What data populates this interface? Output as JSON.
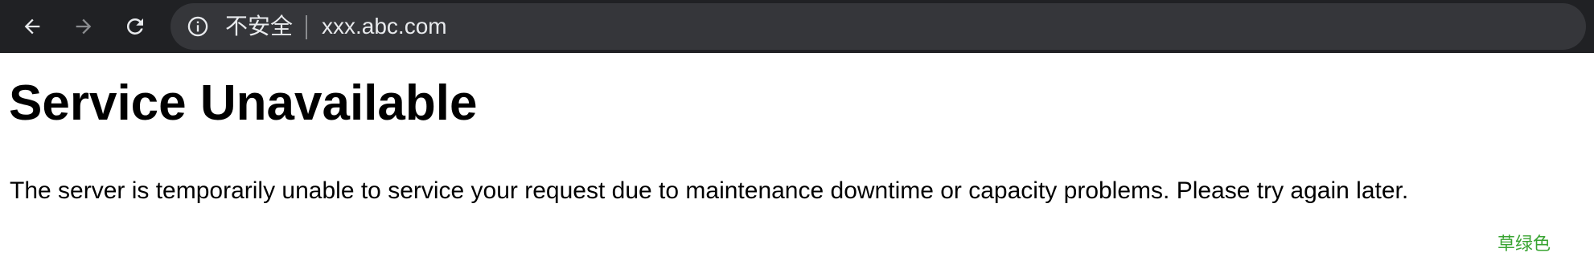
{
  "browser": {
    "security_label": "不安全",
    "url": "xxx.abc.com",
    "icons": {
      "back": "arrow-left-icon",
      "forward": "arrow-right-icon",
      "reload": "reload-icon",
      "info": "info-circle-icon"
    },
    "colors": {
      "toolbar_background": "#202124",
      "omnibox_background": "#35363a",
      "text": "#e8eaed",
      "forward_disabled": "#8a8c8f"
    }
  },
  "page": {
    "title": "Service Unavailable",
    "message": "The server is temporarily unable to service your request due to maintenance downtime or capacity problems. Please try again later."
  },
  "watermark": {
    "text": "草绿色",
    "color": "#39a432"
  }
}
